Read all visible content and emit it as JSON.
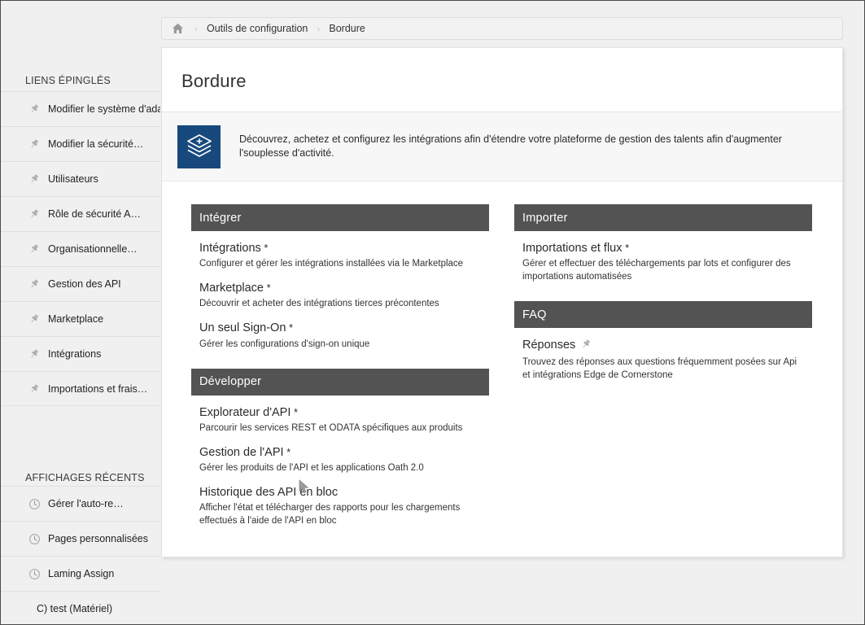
{
  "breadcrumb": {
    "home_icon": "home-icon",
    "items": [
      "Outils de configuration",
      "Bordure"
    ],
    "separator": "›"
  },
  "sidebar": {
    "pinned_header": "LIENS ÉPINGLÉS",
    "pinned_items": [
      {
        "label": "Modifier le système d'adage",
        "icon": "pin-icon"
      },
      {
        "label": "Modifier la sécurité…",
        "icon": "pin-icon"
      },
      {
        "label": "Utilisateurs",
        "icon": "pin-icon"
      },
      {
        "label": "Rôle de sécurité A…",
        "icon": "pin-icon"
      },
      {
        "label": "Organisationnelle…",
        "icon": "pin-icon"
      },
      {
        "label": "Gestion des API",
        "icon": "pin-icon"
      },
      {
        "label": "Marketplace",
        "icon": "pin-icon"
      },
      {
        "label": "Intégrations",
        "icon": "pin-icon"
      },
      {
        "label": "Importations et frais…",
        "icon": "pin-icon"
      }
    ],
    "recent_header": "AFFICHAGES RÉCENTS",
    "recent_items": [
      {
        "label": "Gérer l'auto-re…",
        "icon": "clock-icon"
      },
      {
        "label": "Pages personnalisées",
        "icon": "clock-icon"
      },
      {
        "label": "Laming Assign",
        "icon": "clock-icon"
      },
      {
        "label": "C) test (Matériel)",
        "icon": "none"
      }
    ]
  },
  "page": {
    "title": "Bordure",
    "banner_icon": "layers-stack-icon",
    "banner_icon_bg": "#17497d",
    "banner_text": "Découvrez, achetez et configurez les intégrations afin d'étendre votre plateforme de gestion des talents afin d'augmenter l'souplesse d'activité."
  },
  "panels": {
    "header_bg": "#535353",
    "left": [
      {
        "header": "Intégrer",
        "entries": [
          {
            "title": "Intégrations",
            "star": "*",
            "desc": "Configurer et gérer les intégrations installées via le Marketplace"
          },
          {
            "title": "Marketplace",
            "star": "*",
            "desc": "Découvrir et acheter des intégrations tierces précontentes"
          },
          {
            "title": "Un seul Sign-On",
            "star": "*",
            "desc": "Gérer les configurations d'sign-on unique"
          }
        ]
      },
      {
        "header": "Développer",
        "entries": [
          {
            "title": "Explorateur d'API",
            "star": "*",
            "desc": "Parcourir les services REST et ODATA spécifiques aux produits"
          },
          {
            "title": "Gestion de l'API",
            "star": "*",
            "desc": "Gérer les produits de l'API et les applications Oath 2.0"
          },
          {
            "title": "Historique des API en bloc",
            "star": "",
            "desc": "Afficher l'état et télécharger des rapports pour les chargements effectués à l'aide de l'API en bloc"
          }
        ]
      }
    ],
    "right": [
      {
        "header": "Importer",
        "entries": [
          {
            "title": "Importations et flux",
            "star": "*",
            "desc": "Gérer et effectuer des téléchargements par lots et configurer des importations automatisées"
          }
        ]
      },
      {
        "header": "FAQ",
        "entries": [
          {
            "title": "Réponses",
            "star": "",
            "pin": "pin-icon",
            "desc": "Trouvez des réponses aux questions fréquemment posées sur Api et intégrations Edge de Cornerstone"
          }
        ]
      }
    ]
  }
}
